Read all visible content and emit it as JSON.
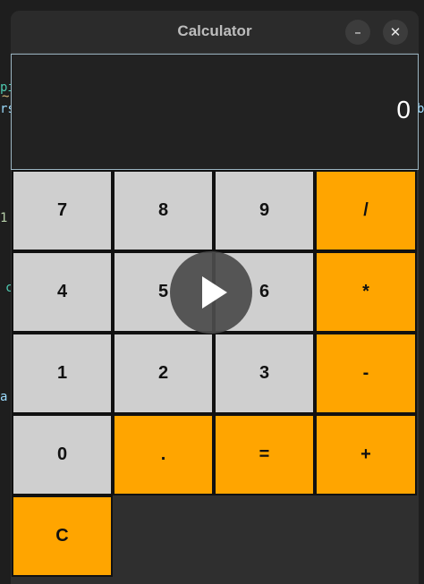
{
  "window": {
    "title": "Calculator",
    "minimize_glyph": "–",
    "close_glyph": "✕"
  },
  "display": {
    "value": "0"
  },
  "keys": {
    "k7": "7",
    "k8": "8",
    "k9": "9",
    "div": "/",
    "k4": "4",
    "k5": "5",
    "k6": "6",
    "mul": "*",
    "k1": "1",
    "k2": "2",
    "k3": "3",
    "sub": "-",
    "k0": "0",
    "dot": ".",
    "eq": "=",
    "add": "+",
    "clear": "C"
  },
  "background_editor": {
    "fragments": [
      "pi",
      "~",
      "rs",
      "b",
      "1",
      "c",
      "a"
    ]
  },
  "overlay": {
    "icon": "play-icon"
  },
  "colors": {
    "number_key": "#cfcfcf",
    "operator_key": "#ffa500",
    "display_bg": "#222222",
    "window_bg": "#2f2f2f"
  }
}
